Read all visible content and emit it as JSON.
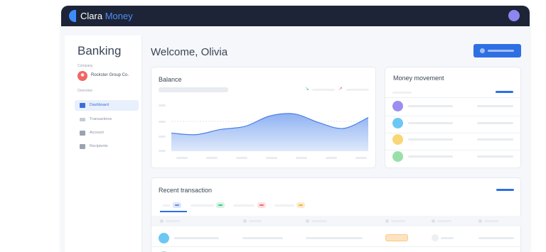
{
  "app": {
    "brand_part1": "Clara",
    "brand_part2": "Money",
    "brand_colors": {
      "primary": "#2f6fe4",
      "dark": "#1d2437"
    }
  },
  "sidebar": {
    "title": "Banking",
    "company_caption": "Company",
    "company_name": "Rockster Group Co.",
    "overview_caption": "Overview",
    "items": [
      {
        "label": "Dashboard",
        "icon": "home-icon",
        "active": true
      },
      {
        "label": "Transactions",
        "icon": "list-icon",
        "active": false
      },
      {
        "label": "Account",
        "icon": "bank-icon",
        "active": false
      },
      {
        "label": "Recipients",
        "icon": "people-icon",
        "active": false
      }
    ]
  },
  "main": {
    "welcome": "Welcome, Olivia"
  },
  "balance": {
    "title": "Balance",
    "chart_data": {
      "type": "area",
      "title": "",
      "xlabel": "",
      "ylabel": "",
      "x": [
        0,
        1,
        2,
        3,
        4,
        5,
        6,
        7,
        8
      ],
      "values": [
        0.35,
        0.32,
        0.42,
        0.48,
        0.68,
        0.72,
        0.55,
        0.44,
        0.65
      ],
      "ylim": [
        0,
        1
      ],
      "grid": false,
      "colors": {
        "line": "#4a7fe6",
        "fill_top": "#8fb2f2",
        "fill_bottom": "#dfe9fb"
      }
    }
  },
  "money_movement": {
    "title": "Money movement",
    "row_colors": [
      "#9c8ef0",
      "#6cc7f4",
      "#f9d778",
      "#98e0a8"
    ]
  },
  "recent": {
    "title": "Recent transaction",
    "tab_chip_colors": [
      "#5b8df0",
      "#41c48a",
      "#f06b6b",
      "#f2b14a"
    ],
    "row_avatar_colors": [
      "#6cc7f4",
      "#98e0a8"
    ],
    "status_chip_colors": [
      "#f9c985",
      "#a8e3c4"
    ]
  }
}
